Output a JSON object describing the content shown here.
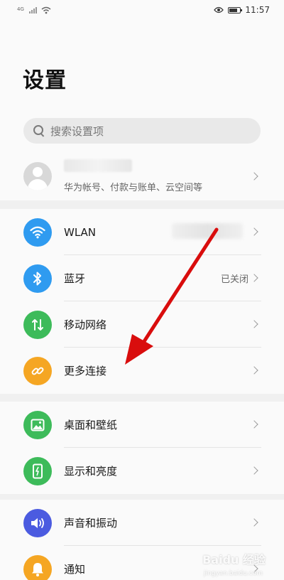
{
  "status_bar": {
    "network_type": "4G",
    "time": "11:57"
  },
  "header": {
    "title": "设置"
  },
  "search": {
    "placeholder": "搜索设置项"
  },
  "account": {
    "subtitle": "华为帐号、付款与账单、云空间等"
  },
  "groups": [
    {
      "items": [
        {
          "label": "WLAN",
          "value": "",
          "icon": "wifi-icon",
          "color": "#2f9bf0"
        },
        {
          "label": "蓝牙",
          "value": "已关闭",
          "icon": "bluetooth-icon",
          "color": "#2f9bf0"
        },
        {
          "label": "移动网络",
          "value": "",
          "icon": "mobile-data-icon",
          "color": "#3dbb5a"
        },
        {
          "label": "更多连接",
          "value": "",
          "icon": "link-icon",
          "color": "#f5a623"
        }
      ]
    },
    {
      "items": [
        {
          "label": "桌面和壁纸",
          "value": "",
          "icon": "wallpaper-icon",
          "color": "#3dbb5a"
        },
        {
          "label": "显示和亮度",
          "value": "",
          "icon": "display-icon",
          "color": "#3dbb5a"
        }
      ]
    },
    {
      "items": [
        {
          "label": "声音和振动",
          "value": "",
          "icon": "sound-icon",
          "color": "#4b5be0"
        },
        {
          "label": "通知",
          "value": "",
          "icon": "notification-icon",
          "color": "#f5a623"
        }
      ]
    }
  ],
  "watermark": {
    "text": "Baidu 经验",
    "sub": "jingyan.baidu.com"
  }
}
